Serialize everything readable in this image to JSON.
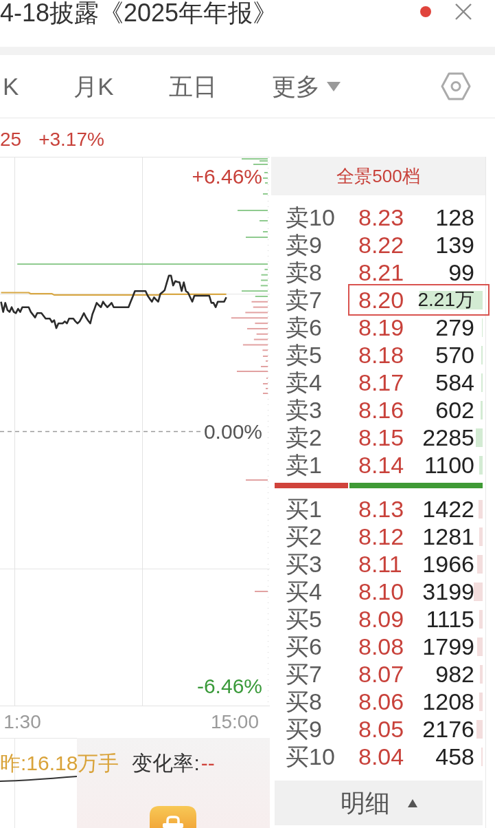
{
  "header": {
    "title": "4-18披露《2025年年报》",
    "unread": true
  },
  "tabs": [
    {
      "label": "K",
      "kind": "tab",
      "selected": false
    },
    {
      "label": "月K",
      "kind": "tab",
      "selected": false
    },
    {
      "label": "五日",
      "kind": "tab",
      "selected": false
    },
    {
      "label": "更多",
      "kind": "menu",
      "selected": false
    }
  ],
  "quote": {
    "change": "25",
    "change_percent": "+3.17%"
  },
  "chart": {
    "chart_data": {
      "type": "line",
      "categories": [
        null,
        null,
        null,
        null,
        null,
        null,
        null,
        null,
        null,
        null,
        "1:30",
        null,
        null,
        null,
        null,
        null,
        null,
        null,
        null,
        null,
        null,
        null,
        null,
        null,
        null,
        null,
        null,
        null,
        null,
        null,
        null,
        null,
        null,
        null,
        null,
        null,
        null,
        null,
        null,
        null,
        null,
        null,
        null,
        null,
        null,
        null,
        null,
        null,
        null,
        null,
        null,
        null,
        null,
        null,
        null,
        null,
        null,
        null,
        null,
        null,
        null,
        null,
        null,
        null,
        null,
        null,
        null,
        null,
        null,
        null,
        null,
        null,
        null,
        null,
        null,
        null,
        null,
        null,
        null,
        null,
        null,
        null,
        null,
        null,
        null,
        null,
        null,
        null,
        null,
        null,
        null,
        null,
        null,
        null,
        null,
        null,
        null,
        null,
        null,
        null,
        null,
        null,
        null,
        null,
        null,
        null,
        null,
        null,
        null,
        null,
        "15:00",
        null,
        null,
        null,
        null,
        null,
        null,
        null,
        null,
        null,
        null,
        null,
        null,
        null,
        null,
        null,
        null
      ],
      "ylim": [
        -6.96,
        6.96
      ],
      "yticks": [
        {
          "value": 6.46,
          "label": "+6.46%"
        },
        {
          "value": 0,
          "label": "0.00%"
        },
        {
          "value": -6.46,
          "label": "-6.46%"
        }
      ],
      "series": [
        {
          "color": "#2b2b2b",
          "values": [
            3.29,
            3.03,
            3.26,
            3.08,
            3.03,
            3.15,
            3.03,
            3.0,
            3.11,
            3.03,
            3.15,
            3.15,
            3.15,
            3.15,
            3.03,
            2.96,
            2.89,
            3.0,
            3.0,
            3.0,
            2.93,
            2.86,
            2.86,
            2.86,
            2.77,
            2.82,
            2.62,
            2.74,
            2.74,
            2.74,
            2.79,
            2.74,
            2.86,
            2.86,
            2.86,
            2.79,
            2.74,
            2.79,
            2.89,
            3.0,
            2.89,
            2.81,
            2.74,
            2.97,
            3.11,
            3.26,
            3.2,
            3.15,
            3.29,
            3.21,
            3.15,
            3.2,
            3.26,
            3.15,
            3.15,
            3.15,
            3.15,
            3.15,
            3.15,
            3.15,
            3.15,
            3.29,
            3.42,
            3.56,
            3.56,
            3.56,
            3.56,
            3.56,
            3.56,
            3.44,
            3.36,
            3.29,
            3.4,
            3.34,
            3.29,
            3.49,
            3.53,
            3.58,
            3.77,
            3.95,
            3.95,
            3.7,
            3.81,
            3.79,
            3.78,
            3.56,
            3.78,
            3.56,
            3.52,
            3.4,
            3.29,
            3.44,
            3.44,
            3.44,
            3.44,
            3.44,
            3.44,
            3.44,
            3.44,
            3.26,
            3.26,
            3.15,
            3.29,
            3.29,
            3.29,
            3.29,
            3.4,
            null,
            null,
            null,
            null,
            null,
            null,
            null,
            null,
            null,
            null,
            null,
            null,
            null,
            null,
            null,
            null,
            null,
            null,
            null,
            null
          ]
        },
        {
          "color": "#d8a845",
          "values": [
            3.52,
            3.52,
            3.52,
            3.52,
            3.52,
            3.52,
            3.52,
            3.52,
            3.52,
            3.52,
            3.52,
            3.52,
            3.52,
            3.52,
            3.49,
            3.49,
            3.49,
            3.49,
            3.49,
            3.49,
            3.49,
            3.49,
            3.49,
            3.49,
            3.49,
            3.46,
            3.46,
            3.46,
            3.46,
            3.46,
            3.46,
            3.46,
            3.46,
            3.46,
            3.46,
            3.46,
            3.46,
            3.46,
            3.46,
            3.46,
            3.46,
            3.46,
            3.46,
            3.46,
            3.46,
            3.46,
            3.46,
            3.46,
            3.46,
            3.46,
            3.46,
            3.46,
            3.46,
            3.46,
            3.46,
            3.46,
            3.46,
            3.46,
            3.46,
            3.46,
            3.46,
            3.46,
            3.46,
            3.46,
            3.46,
            3.46,
            3.46,
            3.46,
            3.46,
            3.46,
            3.46,
            3.46,
            3.46,
            3.46,
            3.46,
            3.48,
            3.48,
            3.48,
            3.48,
            3.48,
            3.48,
            3.48,
            3.48,
            3.48,
            3.48,
            3.48,
            3.48,
            3.48,
            3.48,
            3.48,
            3.48,
            3.48,
            3.48,
            3.48,
            3.48,
            3.48,
            3.48,
            3.48,
            3.48,
            3.48,
            3.48,
            3.48,
            3.48,
            3.48,
            3.48,
            3.48,
            3.48,
            null,
            null,
            null,
            null,
            null,
            null,
            null,
            null,
            null,
            null,
            null,
            null,
            null,
            null,
            null,
            null,
            null,
            null,
            null,
            null
          ]
        }
      ]
    }
  },
  "volume_panel": {
    "yesterday": "昨:16.18万手",
    "rate_label": "变化率:",
    "rate_value": "--"
  },
  "order_book": {
    "title": "全景500档",
    "asks": [
      {
        "label": "卖10",
        "price": "8.23",
        "volume": "128",
        "highlighted": false
      },
      {
        "label": "卖9",
        "price": "8.22",
        "volume": "139",
        "highlighted": false
      },
      {
        "label": "卖8",
        "price": "8.21",
        "volume": "99",
        "highlighted": false
      },
      {
        "label": "卖7",
        "price": "8.20",
        "volume": "2.21万",
        "level": 0.96,
        "highlighted": true
      },
      {
        "label": "卖6",
        "price": "8.19",
        "volume": "279",
        "level": 0.012,
        "highlighted": false
      },
      {
        "label": "卖5",
        "price": "8.18",
        "volume": "570",
        "level": 0.025,
        "highlighted": false
      },
      {
        "label": "卖4",
        "price": "8.17",
        "volume": "584",
        "level": 0.026,
        "highlighted": false
      },
      {
        "label": "卖3",
        "price": "8.16",
        "volume": "602",
        "level": 0.027,
        "highlighted": false
      },
      {
        "label": "卖2",
        "price": "8.15",
        "volume": "2285",
        "level": 0.1,
        "highlighted": false
      },
      {
        "label": "卖1",
        "price": "8.14",
        "volume": "1100",
        "level": 0.048,
        "highlighted": false
      }
    ],
    "ratio_bar": {
      "level": 0.36
    },
    "bids": [
      {
        "label": "买1",
        "price": "8.13",
        "volume": "1422",
        "level": 0.062,
        "highlighted": false
      },
      {
        "label": "买2",
        "price": "8.12",
        "volume": "1281",
        "level": 0.056,
        "highlighted": false
      },
      {
        "label": "买3",
        "price": "8.11",
        "volume": "1966",
        "level": 0.086,
        "highlighted": false
      },
      {
        "label": "买4",
        "price": "8.10",
        "volume": "3199",
        "level": 0.14,
        "highlighted": false
      },
      {
        "label": "买5",
        "price": "8.09",
        "volume": "1115",
        "level": 0.049,
        "highlighted": false
      },
      {
        "label": "买6",
        "price": "8.08",
        "volume": "1799",
        "level": 0.079,
        "highlighted": false
      },
      {
        "label": "买7",
        "price": "8.07",
        "volume": "982",
        "level": 0.043,
        "highlighted": false
      },
      {
        "label": "买8",
        "price": "8.06",
        "volume": "1208",
        "level": 0.053,
        "highlighted": false
      },
      {
        "label": "买9",
        "price": "8.05",
        "volume": "2176",
        "level": 0.095,
        "highlighted": false
      },
      {
        "label": "买10",
        "price": "8.04",
        "volume": "458",
        "level": 0.02,
        "highlighted": false
      }
    ],
    "detail_button": {
      "label": "明细"
    }
  }
}
